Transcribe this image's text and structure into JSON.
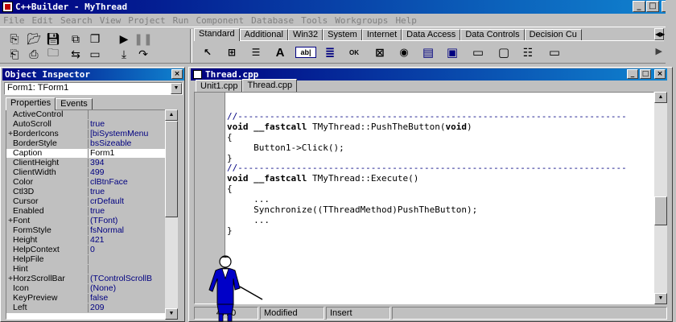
{
  "window": {
    "title": "C++Builder - MyThread",
    "controls": [
      "_",
      "□",
      "×"
    ]
  },
  "menu": [
    "File",
    "Edit",
    "Search",
    "View",
    "Project",
    "Run",
    "Component",
    "Database",
    "Tools",
    "Workgroups",
    "Help"
  ],
  "palette": {
    "tabs": [
      "Standard",
      "Additional",
      "Win32",
      "System",
      "Internet",
      "Data Access",
      "Data Controls",
      "Decision Cu"
    ],
    "active_tab": "Standard",
    "components": [
      {
        "icon": "pointer-arrow-icon",
        "glyph": "↖"
      },
      {
        "icon": "frames-icon",
        "glyph": "⊞"
      },
      {
        "icon": "main-menu-icon",
        "glyph": "☰"
      },
      {
        "icon": "label-icon",
        "glyph": "A"
      },
      {
        "icon": "edit-icon",
        "glyph": "ab|"
      },
      {
        "icon": "memo-icon",
        "glyph": "≣"
      },
      {
        "icon": "button-icon",
        "glyph": "OK"
      },
      {
        "icon": "checkbox-icon",
        "glyph": "⊠"
      },
      {
        "icon": "radiobutton-icon",
        "glyph": "◉"
      },
      {
        "icon": "listbox-icon",
        "glyph": "▤"
      },
      {
        "icon": "combobox-icon",
        "glyph": "▣"
      },
      {
        "icon": "scrollbar-icon",
        "glyph": "▭"
      },
      {
        "icon": "groupbox-icon",
        "glyph": "▢"
      },
      {
        "icon": "radiogroup-icon",
        "glyph": "☷"
      },
      {
        "icon": "panel-icon",
        "glyph": "▭"
      }
    ]
  },
  "inspector": {
    "title": "Object Inspector",
    "selected_object": "Form1: TForm1",
    "tabs": [
      "Properties",
      "Events"
    ],
    "active_tab": "Properties",
    "properties": [
      {
        "name": "ActiveControl",
        "value": "",
        "expandable": false
      },
      {
        "name": "AutoScroll",
        "value": "true",
        "expandable": false
      },
      {
        "name": "+BorderIcons",
        "value": "[biSystemMenu",
        "expandable": true
      },
      {
        "name": "BorderStyle",
        "value": "bsSizeable",
        "expandable": false
      },
      {
        "name": "Caption",
        "value": "Form1",
        "expandable": false,
        "selected": true
      },
      {
        "name": "ClientHeight",
        "value": "394",
        "expandable": false
      },
      {
        "name": "ClientWidth",
        "value": "499",
        "expandable": false
      },
      {
        "name": "Color",
        "value": "clBtnFace",
        "expandable": false
      },
      {
        "name": "Ctl3D",
        "value": "true",
        "expandable": false
      },
      {
        "name": "Cursor",
        "value": "crDefault",
        "expandable": false
      },
      {
        "name": "Enabled",
        "value": "true",
        "expandable": false
      },
      {
        "name": "+Font",
        "value": "(TFont)",
        "expandable": true
      },
      {
        "name": "FormStyle",
        "value": "fsNormal",
        "expandable": false
      },
      {
        "name": "Height",
        "value": "421",
        "expandable": false
      },
      {
        "name": "HelpContext",
        "value": "0",
        "expandable": false
      },
      {
        "name": "HelpFile",
        "value": "",
        "expandable": false
      },
      {
        "name": "Hint",
        "value": "",
        "expandable": false
      },
      {
        "name": "+HorzScrollBar",
        "value": "(TControlScrollB",
        "expandable": true
      },
      {
        "name": "Icon",
        "value": "(None)",
        "expandable": false
      },
      {
        "name": "KeyPreview",
        "value": "false",
        "expandable": false
      },
      {
        "name": "Left",
        "value": "209",
        "expandable": false
      }
    ]
  },
  "editor": {
    "title": "Thread.cpp",
    "tabs": [
      "Unit1.cpp",
      "Thread.cpp"
    ],
    "active_tab": "Thread.cpp",
    "code_lines": [
      {
        "kind": "sep",
        "text": "//-------------------------------------------------------------------------"
      },
      {
        "kind": "code",
        "pre": "",
        "bold": "void __fastcall",
        "post": " TMyThread::PushTheButton(",
        "bold2": "void",
        "post2": ")"
      },
      {
        "kind": "plain",
        "text": "{"
      },
      {
        "kind": "plain",
        "text": "     Button1->Click();"
      },
      {
        "kind": "plain",
        "text": "}"
      },
      {
        "kind": "sep",
        "text": "//-------------------------------------------------------------------------"
      },
      {
        "kind": "code",
        "pre": "",
        "bold": "void __fastcall",
        "post": " TMyThread::Execute()",
        "bold2": "",
        "post2": ""
      },
      {
        "kind": "plain",
        "text": "{"
      },
      {
        "kind": "plain",
        "text": "     ..."
      },
      {
        "kind": "plain",
        "text": "     Synchronize((TThreadMethod)PushTheButton);"
      },
      {
        "kind": "plain",
        "text": "     ..."
      },
      {
        "kind": "plain",
        "text": "}"
      }
    ],
    "status": {
      "position": "47: 0",
      "modified": "Modified",
      "mode": "Insert"
    }
  }
}
